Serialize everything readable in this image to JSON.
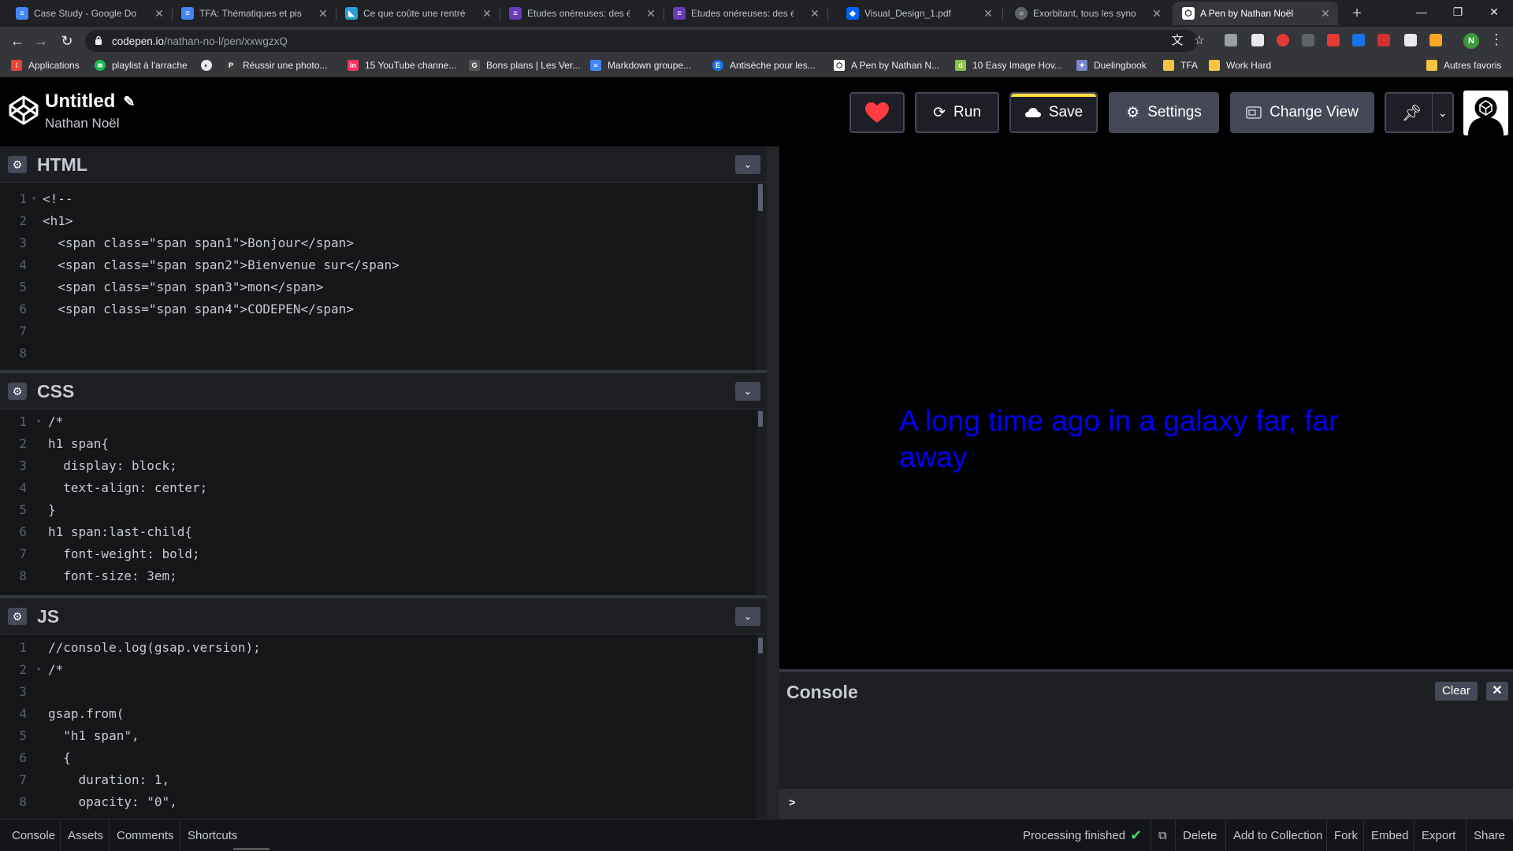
{
  "browser": {
    "tabs": [
      {
        "title": "Case Study - Google Docs",
        "icon": "google-docs-icon",
        "color": "#4285f4"
      },
      {
        "title": "TFA: Thématiques et pistes",
        "icon": "google-docs-icon",
        "color": "#4285f4"
      },
      {
        "title": "Ce que coûte une rentrée sc",
        "icon": "news-site-icon",
        "color": "#2a9fd6"
      },
      {
        "title": "Etudes onéreuses: des étud",
        "icon": "google-forms-icon",
        "color": "#673ab7"
      },
      {
        "title": "Etudes onéreuses: des étud",
        "icon": "google-forms-icon",
        "color": "#673ab7"
      },
      {
        "title": "Visual_Design_1.pdf",
        "icon": "dropbox-icon",
        "color": "#0061fe"
      },
      {
        "title": "Exorbitant, tous les synonym",
        "icon": "globe-icon",
        "color": "#5f6368"
      },
      {
        "title": "A Pen by Nathan Noël",
        "icon": "codepen-icon",
        "color": "#ffffff"
      }
    ],
    "url_host": "codepen.io",
    "url_path": "/nathan-no-l/pen/xxwgzxQ",
    "bookmarks": [
      {
        "label": "Applications",
        "icon": "apps-grid-icon",
        "color": "#ea4335"
      },
      {
        "label": "playlist à l'arrache",
        "icon": "spotify-icon",
        "color": "#1db954"
      },
      {
        "label": "",
        "icon": "globe-bookmark-icon",
        "color": "#e8eaed"
      },
      {
        "label": "Réussir une photo...",
        "icon": "photo-site-icon",
        "color": "#3b3b3b"
      },
      {
        "label": "15 YouTube channe...",
        "icon": "invision-icon",
        "color": "#ff3366"
      },
      {
        "label": "Bons plans | Les Ver...",
        "icon": "bons-plans-icon",
        "color": "#555555"
      },
      {
        "label": "Markdown groupe...",
        "icon": "google-docs-icon",
        "color": "#4285f4"
      },
      {
        "label": "Antisèche pour les...",
        "icon": "e-site-icon",
        "color": "#1a73e8"
      },
      {
        "label": "A Pen by Nathan N...",
        "icon": "codepen-icon",
        "color": "#ffffff"
      },
      {
        "label": "10 Easy Image Hov...",
        "icon": "d-site-icon",
        "color": "#8bc34a"
      },
      {
        "label": "Duelingbook",
        "icon": "duelingbook-icon",
        "color": "#7986cb"
      },
      {
        "label": "TFA",
        "icon": "folder-icon",
        "color": "#f6c343"
      },
      {
        "label": "Work Hard",
        "icon": "folder-icon",
        "color": "#f6c343"
      },
      {
        "label": "Autres favoris",
        "icon": "folder-icon",
        "color": "#f6c343"
      }
    ],
    "profile_initial": "N"
  },
  "codepen": {
    "title": "Untitled",
    "author": "Nathan Noël",
    "buttons": {
      "run": "Run",
      "save": "Save",
      "settings": "Settings",
      "change_view": "Change View"
    },
    "colors": {
      "accent_yellow": "#ffdd40",
      "heart": "#ff3c41",
      "button_bg": "#444857"
    }
  },
  "editors": {
    "html": {
      "label": "HTML",
      "lines": [
        "<!--",
        "<h1>",
        "  <span class=\"span span1\">Bonjour</span>",
        "  <span class=\"span span2\">Bienvenue sur</span>",
        "  <span class=\"span span3\">mon</span>",
        "  <span class=\"span span4\">CODEPEN</span>",
        "",
        ""
      ]
    },
    "css": {
      "label": "CSS",
      "lines": [
        "/*",
        "h1 span{",
        "  display: block;",
        "  text-align: center;",
        "}",
        "h1 span:last-child{",
        "  font-weight: bold;",
        "  font-size: 3em;"
      ]
    },
    "js": {
      "label": "JS",
      "lines": [
        "//console.log(gsap.version);",
        "/*",
        "",
        "gsap.from(",
        "  \"h1 span\",",
        "  {",
        "    duration: 1,",
        "    opacity: \"0\","
      ]
    }
  },
  "preview": {
    "text": "A long time ago in a galaxy far, far away",
    "text_color": "#0000ff"
  },
  "console": {
    "title": "Console",
    "clear": "Clear",
    "prompt": ">"
  },
  "footer": {
    "left": [
      "Console",
      "Assets",
      "Comments",
      "Shortcuts"
    ],
    "status": "Processing finished",
    "right": [
      "Delete",
      "Add to Collection",
      "Fork",
      "Embed",
      "Export",
      "Share"
    ]
  }
}
